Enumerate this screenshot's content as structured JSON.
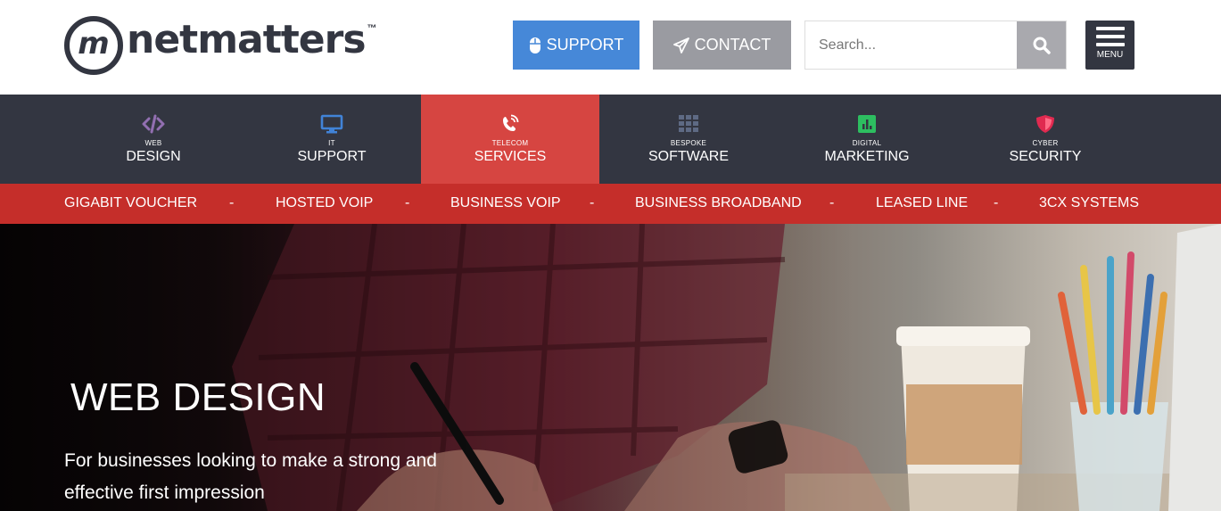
{
  "brand": {
    "name": "netmatters",
    "mark": "m",
    "tm": "™"
  },
  "header": {
    "support_label": "SUPPORT",
    "contact_label": "CONTACT",
    "search_placeholder": "Search...",
    "menu_label": "MENU"
  },
  "nav": {
    "items": [
      {
        "small": "WEB",
        "big": "DESIGN",
        "icon": "code-icon",
        "color": "#926fb1"
      },
      {
        "small": "IT",
        "big": "SUPPORT",
        "icon": "monitor-icon",
        "color": "#4183d7"
      },
      {
        "small": "TELECOM",
        "big": "SERVICES",
        "icon": "phone-icon",
        "color": "#ffffff"
      },
      {
        "small": "BESPOKE",
        "big": "SOFTWARE",
        "icon": "grid-icon",
        "color": "#5e6a84"
      },
      {
        "small": "DIGITAL",
        "big": "MARKETING",
        "icon": "chart-icon",
        "color": "#2dbe60"
      },
      {
        "small": "CYBER",
        "big": "SECURITY",
        "icon": "shield-icon",
        "color": "#e02a50"
      }
    ]
  },
  "subnav": {
    "items": [
      "GIGABIT VOUCHER",
      "HOSTED VOIP",
      "BUSINESS VOIP",
      "BUSINESS BROADBAND",
      "LEASED LINE",
      "3CX SYSTEMS"
    ],
    "separator": "-"
  },
  "hero": {
    "title": "WEB DESIGN",
    "subtitle": "For businesses looking to make a strong and effective first impression"
  },
  "colors": {
    "support_button": "#4688d8",
    "contact_button": "#9a9ba1",
    "nav_background": "#333641",
    "nav_active": "#d64541",
    "subnav_background": "#c52e2a"
  }
}
